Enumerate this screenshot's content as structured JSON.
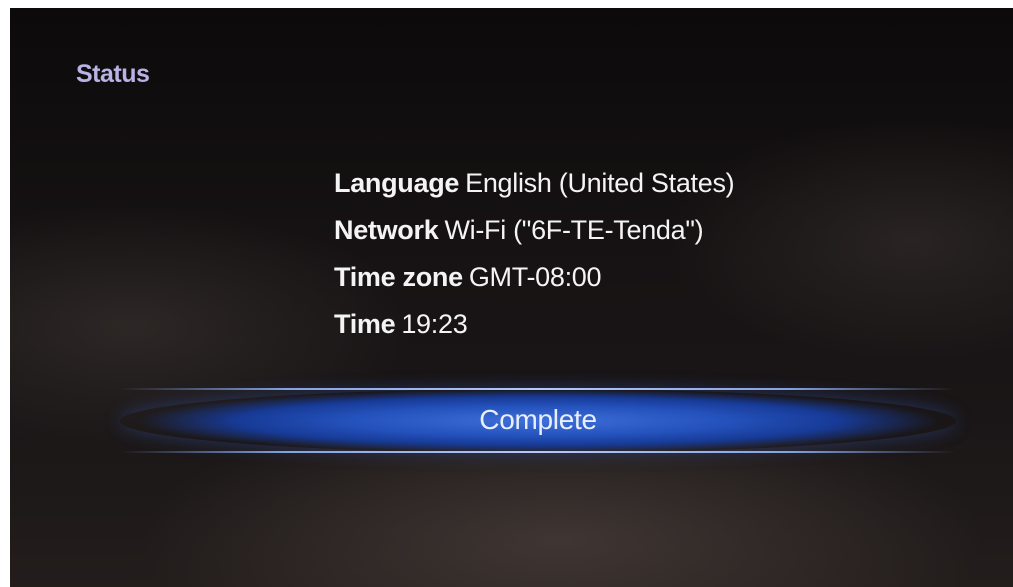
{
  "screen": {
    "title": "Status"
  },
  "summary": {
    "rows": [
      {
        "key": "Language",
        "value": "English (United States)"
      },
      {
        "key": "Network",
        "value": "Wi-Fi (\"6F-TE-Tenda\")"
      },
      {
        "key": "Time zone",
        "value": "GMT-08:00"
      },
      {
        "key": "Time",
        "value": "19:23"
      }
    ]
  },
  "actions": {
    "complete_label": "Complete"
  },
  "colors": {
    "title": "#b9b2e4",
    "accent": "#2553be",
    "text": "#f4f4f4"
  }
}
